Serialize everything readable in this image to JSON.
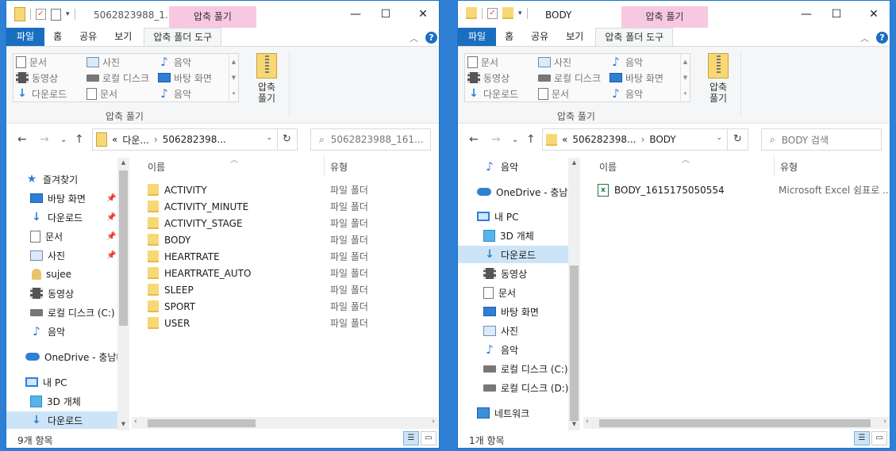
{
  "left": {
    "title": "5062823988_1...",
    "context_tab": "압축 풀기",
    "tabs": {
      "file": "파일",
      "home": "홈",
      "share": "공유",
      "view": "보기",
      "tool": "압축 폴더 도구"
    },
    "gallery": [
      "문서",
      "사진",
      "음악",
      "동영상",
      "로컬 디스크",
      "바탕 화면",
      "다운로드",
      "문서",
      "음악"
    ],
    "extract_all": "압축\n풀기",
    "group_label": "압축 풀기",
    "address": {
      "prefix": "«",
      "parts": [
        "다운...",
        "506282398..."
      ]
    },
    "search_placeholder": "5062823988_161...",
    "nav_items": [
      {
        "label": "즐겨찾기",
        "icon": "star-icon"
      },
      {
        "label": "바탕 화면",
        "icon": "desktop-icon"
      },
      {
        "label": "다운로드",
        "icon": "download-icon"
      },
      {
        "label": "문서",
        "icon": "document-icon"
      },
      {
        "label": "사진",
        "icon": "picture-icon"
      },
      {
        "label": "sujee",
        "icon": "user-folder-icon"
      },
      {
        "label": "동영상",
        "icon": "video-icon"
      },
      {
        "label": "로컬 디스크 (C:)",
        "icon": "drive-icon"
      },
      {
        "label": "음악",
        "icon": "music-icon"
      },
      {
        "label": "OneDrive - 충남대",
        "icon": "onedrive-icon"
      },
      {
        "label": "내 PC",
        "icon": "pc-icon"
      },
      {
        "label": "3D 개체",
        "icon": "3d-objects-icon"
      },
      {
        "label": "다운로드",
        "icon": "download-icon"
      }
    ],
    "columns": {
      "name": "이름",
      "type": "유형"
    },
    "files": [
      {
        "name": "ACTIVITY",
        "type": "파일 폴더"
      },
      {
        "name": "ACTIVITY_MINUTE",
        "type": "파일 폴더"
      },
      {
        "name": "ACTIVITY_STAGE",
        "type": "파일 폴더"
      },
      {
        "name": "BODY",
        "type": "파일 폴더"
      },
      {
        "name": "HEARTRATE",
        "type": "파일 폴더"
      },
      {
        "name": "HEARTRATE_AUTO",
        "type": "파일 폴더"
      },
      {
        "name": "SLEEP",
        "type": "파일 폴더"
      },
      {
        "name": "SPORT",
        "type": "파일 폴더"
      },
      {
        "name": "USER",
        "type": "파일 폴더"
      }
    ],
    "status": "9개 항목"
  },
  "right": {
    "title": "BODY",
    "context_tab": "압축 풀기",
    "tabs": {
      "file": "파일",
      "home": "홈",
      "share": "공유",
      "view": "보기",
      "tool": "압축 폴더 도구"
    },
    "gallery": [
      "문서",
      "사진",
      "음악",
      "동영상",
      "로컬 디스크",
      "바탕 화면",
      "다운로드",
      "문서",
      "음악"
    ],
    "extract_all": "압축\n풀기",
    "group_label": "압축 풀기",
    "address": {
      "prefix": "«",
      "parts": [
        "506282398...",
        "BODY"
      ]
    },
    "search_placeholder": "BODY 검색",
    "nav_items": [
      {
        "label": "음악",
        "icon": "music-icon"
      },
      {
        "label": "OneDrive - 충남대",
        "icon": "onedrive-icon"
      },
      {
        "label": "내 PC",
        "icon": "pc-icon"
      },
      {
        "label": "3D 개체",
        "icon": "3d-objects-icon"
      },
      {
        "label": "다운로드",
        "icon": "download-icon"
      },
      {
        "label": "동영상",
        "icon": "video-icon"
      },
      {
        "label": "문서",
        "icon": "document-icon"
      },
      {
        "label": "바탕 화면",
        "icon": "desktop-icon"
      },
      {
        "label": "사진",
        "icon": "picture-icon"
      },
      {
        "label": "음악",
        "icon": "music-icon"
      },
      {
        "label": "로컬 디스크 (C:)",
        "icon": "drive-icon"
      },
      {
        "label": "로컬 디스크 (D:)",
        "icon": "drive-icon"
      },
      {
        "label": "네트워크",
        "icon": "network-icon"
      }
    ],
    "columns": {
      "name": "이름",
      "type": "유형"
    },
    "files": [
      {
        "name": "BODY_1615175050554",
        "type": "Microsoft Excel 쉼표로 ..."
      }
    ],
    "status": "1개 항목"
  },
  "colors": {
    "accent": "#1a6ec0",
    "context_tab": "#f7c8e0",
    "selection": "#cce4f7",
    "desktop": "#2f7fd4"
  }
}
